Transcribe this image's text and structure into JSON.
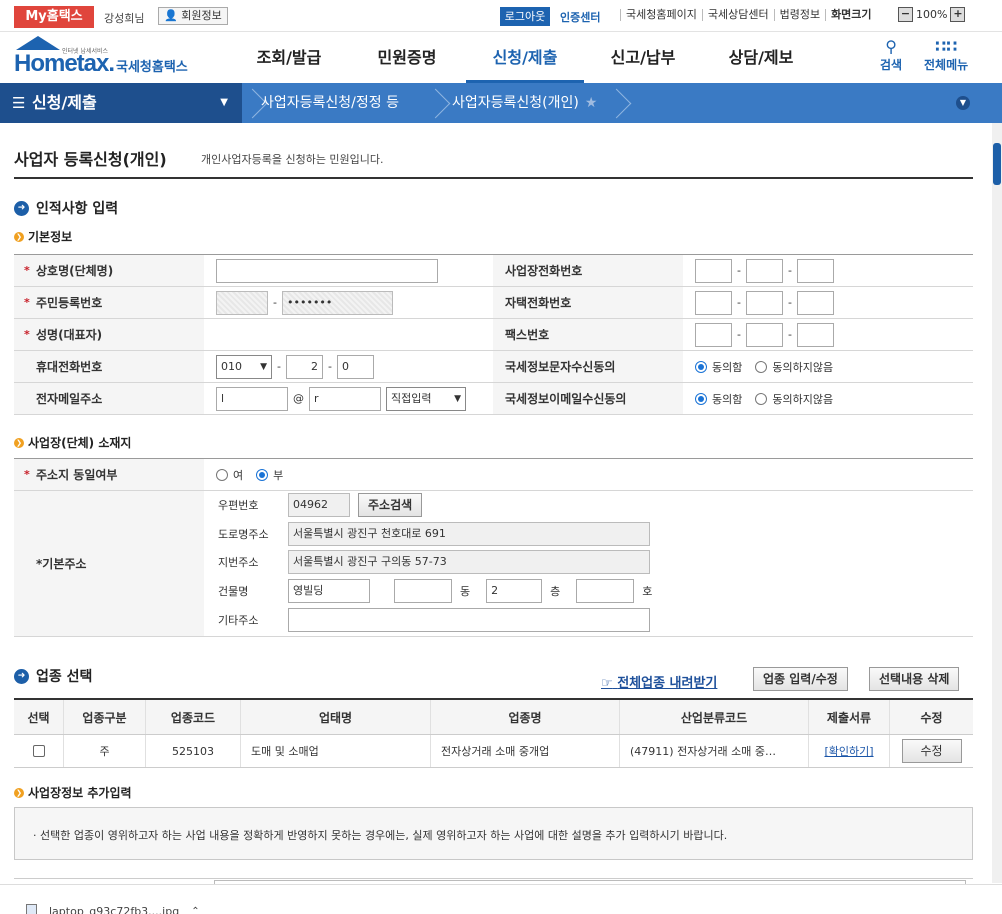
{
  "topbar": {
    "my_label": "My홈택스",
    "user_name": "강성희님",
    "member_label": "회원정보",
    "logout_label": "로그아웃",
    "cert_label": "인증센터",
    "links": [
      "국세청홈페이지",
      "국세상담센터",
      "법령정보",
      "화면크기"
    ],
    "zoom_minus": "−",
    "zoom_value": "100%",
    "zoom_plus": "+"
  },
  "header": {
    "logo_text": "Hometax.",
    "logo_sub": "인터넷 납세서비스",
    "logo_kr": "국세청홈택스",
    "nav": [
      "조회/발급",
      "민원증명",
      "신청/제출",
      "신고/납부",
      "상담/제보"
    ],
    "active_nav_index": 2,
    "search_label": "검색",
    "menu_label": "전체메뉴"
  },
  "location": {
    "home": "신청/제출",
    "crumbs": [
      "사업자등록신청/정정 등",
      "사업자등록신청(개인)"
    ]
  },
  "page": {
    "title": "사업자 등록신청(개인)",
    "desc": "개인사업자등록을 신청하는 민원입니다."
  },
  "personal": {
    "section_title": "인적사항 입력",
    "basic_title": "기본정보",
    "rows": [
      {
        "label": "상호명(단체명)",
        "required": true,
        "right_label": "사업장전화번호"
      },
      {
        "label": "주민등록번호",
        "required": true,
        "right_label": "자택전화번호"
      },
      {
        "label": "성명(대표자)",
        "required": true,
        "right_label": "팩스번호"
      },
      {
        "label": "휴대전화번호",
        "required": false,
        "right_label": "국세정보문자수신동의"
      },
      {
        "label": "전자메일주소",
        "required": false,
        "right_label": "국세정보이메일수신동의"
      }
    ],
    "rrn_masked": "•••••••",
    "mobile_prefix": "010",
    "mobile_mid": "2",
    "mobile_last": "0",
    "email_id": "l",
    "email_at": "@",
    "email_domain": "r",
    "email_select": "직접입력",
    "agree_label": "동의함",
    "disagree_label": "동의하지않음",
    "dash": "-"
  },
  "location_section": {
    "title": "사업장(단체) 소재지",
    "same_label": "주소지 동일여부",
    "yes_label": "여",
    "no_label": "부",
    "addr_label": "기본주소",
    "zip_label": "우편번호",
    "zip_value": "04962",
    "search_btn": "주소검색",
    "road_label": "도로명주소",
    "road_value": "서울특별시 광진구 천호대로 691",
    "lot_label": "지번주소",
    "lot_value": "서울특별시 광진구 구의동 57-73",
    "building_label": "건물명",
    "building_value": "영빌딩",
    "dong_unit": "동",
    "floor_value": "2",
    "floor_unit": "층",
    "ho_unit": "호",
    "other_label": "기타주소"
  },
  "industry": {
    "title": "업종 선택",
    "download_link": "전체업종 내려받기",
    "edit_btn": "업종 입력/수정",
    "delete_btn": "선택내용 삭제",
    "columns": [
      "선택",
      "업종구분",
      "업종코드",
      "업태명",
      "업종명",
      "산업분류코드",
      "제출서류",
      "수정"
    ],
    "row": {
      "type": "주",
      "code": "525103",
      "biz_type": "도매 및 소매업",
      "biz_name": "전자상거래 소매 중개업",
      "ksic": "(47911) 전자상거래 소매 중…",
      "docs": "[확인하기]",
      "edit": "수정"
    }
  },
  "extra": {
    "title": "사업장정보 추가입력",
    "notice": "· 선택한 업종이 영위하고자 하는 사업 내용을 정확하게 반영하지 못하는 경우에는, 실제 영위하고자 하는 사업에 대한 설명을 추가 입력하시기 바랍니다."
  },
  "download_bar": {
    "filename": "laptop_g93c72fb3....jpg"
  },
  "colors": {
    "brand_blue": "#1d63b0",
    "nav_dark": "#1e4f8d",
    "nav_bar": "#3a7ac4",
    "my_red": "#e0453c",
    "required_red": "#c8202a"
  }
}
